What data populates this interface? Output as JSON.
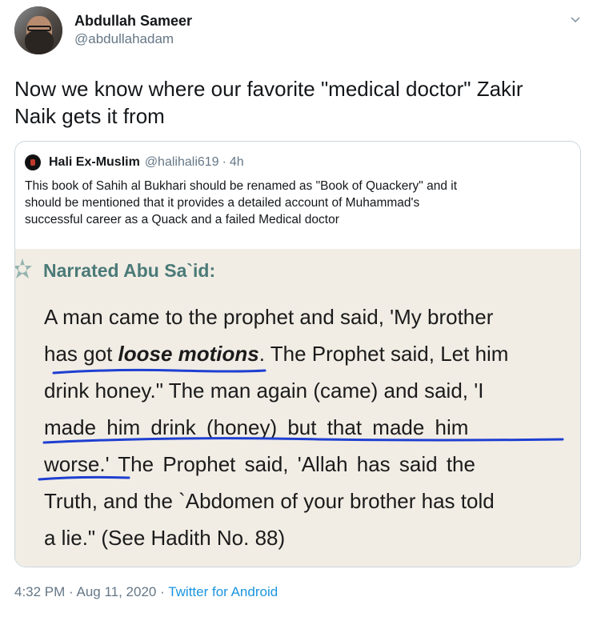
{
  "author": {
    "name": "Abdullah Sameer",
    "handle": "@abdullahadam"
  },
  "tweet": {
    "text_line1": "Now we know where our favorite \"medical doctor\" Zakir",
    "text_line2": "Naik gets it from"
  },
  "quoted": {
    "name": "Hali Ex-Muslim",
    "handle": "@halihali619",
    "separator": "·",
    "time": "4h",
    "text_line1": "This book of Sahih al Bukhari should be renamed as \"Book of Quackery\" and it",
    "text_line2": "should be mentioned that it provides a detailed account of Muhammad's",
    "text_line3": "successful career as a Quack and a failed Medical doctor",
    "image": {
      "heading": "Narrated Abu Sa`id:",
      "line1": "A man came to the prophet and said, 'My brother",
      "line2_pre": "has got ",
      "line2_bold": "loose motions",
      "line2_post": ". The Prophet said, Let him",
      "line3": "drink honey.\" The man again (came) and said, 'I",
      "line4": "made him drink (honey) but that made him",
      "line5": "worse.' The Prophet said, 'Allah has said the",
      "line6": "Truth, and the `Abdomen of your brother has told",
      "line7": "a lie.\" (See Hadith No. 88)"
    }
  },
  "footer": {
    "time": "4:32 PM",
    "sep1": " · ",
    "date": "Aug 11, 2020",
    "sep2": " · ",
    "source": "Twitter for Android"
  },
  "colors": {
    "accent": "#1b95e0",
    "secondary_text": "#657786",
    "ink_underline": "#1f3fd1",
    "image_bg": "#f1ede5",
    "heading_teal": "#4b7a78"
  },
  "icons": [
    "chevron-down-icon"
  ]
}
